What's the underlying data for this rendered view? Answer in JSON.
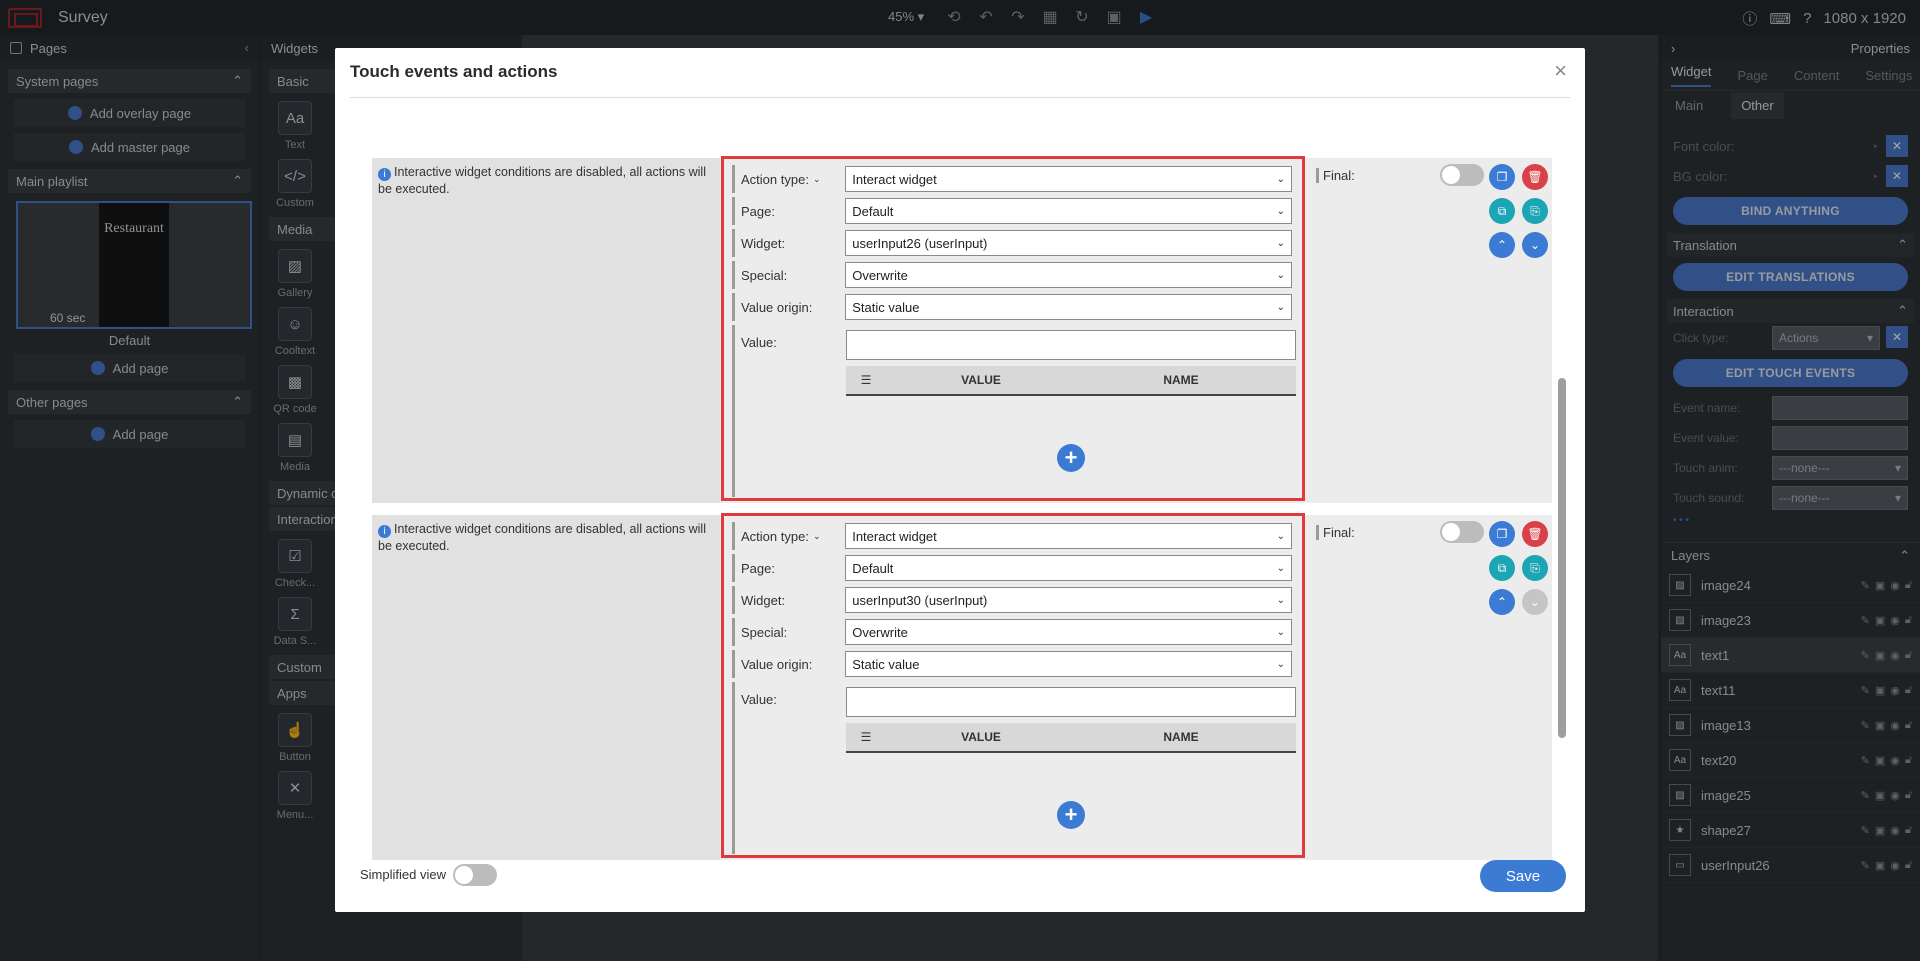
{
  "app": {
    "title": "Survey",
    "zoom": "45% ▾",
    "resolution": "1080 x 1920"
  },
  "pages_panel": {
    "title": "Pages",
    "system_pages": "System pages",
    "add_overlay": "Add overlay page",
    "add_master": "Add master page",
    "main_playlist": "Main playlist",
    "thumb_seconds": "60",
    "thumb_unit": "sec",
    "thumb_title": "Restaurant",
    "thumb_label": "Default",
    "add_page": "Add page",
    "other_pages": "Other pages",
    "add_page2": "Add page"
  },
  "widgets_panel": {
    "title": "Widgets",
    "basic": "Basic",
    "basic_items": [
      "Text",
      "Custom"
    ],
    "media": "Media",
    "media_items": [
      "Gallery",
      "Cooltext",
      "QR code",
      "Media"
    ],
    "dynamic": "Dynamic c",
    "interaction": "Interaction",
    "interaction_items": [
      "Check...",
      "Data S..."
    ],
    "custom": "Custom",
    "apps": "Apps",
    "apps_items": [
      "Button",
      "Menu..."
    ]
  },
  "properties_panel": {
    "title": "Properties",
    "tabs": [
      "Widget",
      "Page",
      "Content",
      "Settings"
    ],
    "subtabs": [
      "Main",
      "Other"
    ],
    "font_color": "Font color:",
    "bg_color": "BG color:",
    "bind_anything": "BIND ANYTHING",
    "translation": "Translation",
    "edit_translations": "EDIT TRANSLATIONS",
    "interaction": "Interaction",
    "click_type_label": "Click type:",
    "click_type_value": "Actions",
    "edit_touch_events": "EDIT TOUCH EVENTS",
    "event_name": "Event name:",
    "event_value": "Event value:",
    "touch_anim_label": "Touch anim:",
    "touch_anim_value": "---none---",
    "touch_sound_label": "Touch sound:",
    "touch_sound_value": "---none---",
    "more": "• • •"
  },
  "layers": {
    "title": "Layers",
    "items": [
      {
        "name": "image24",
        "icon": "image-icon"
      },
      {
        "name": "image23",
        "icon": "image-icon"
      },
      {
        "name": "text1",
        "icon": "text-icon"
      },
      {
        "name": "text11",
        "icon": "text-icon"
      },
      {
        "name": "image13",
        "icon": "image-icon"
      },
      {
        "name": "text20",
        "icon": "text-icon"
      },
      {
        "name": "image25",
        "icon": "image-icon"
      },
      {
        "name": "shape27",
        "icon": "star-icon"
      },
      {
        "name": "userInput26",
        "icon": "input-icon"
      }
    ]
  },
  "modal": {
    "title": "Touch events and actions",
    "note": "Interactive widget conditions are disabled, all actions will be executed.",
    "labels": {
      "action_type": "Action type:",
      "page": "Page:",
      "widget": "Widget:",
      "special": "Special:",
      "value_origin": "Value origin:",
      "value": "Value:",
      "final": "Final:",
      "col_value": "VALUE",
      "col_name": "NAME"
    },
    "actions": [
      {
        "action_type": "Interact widget",
        "page": "Default",
        "widget": "userInput26 (userInput)",
        "special": "Overwrite",
        "value_origin": "Static value",
        "value": ""
      },
      {
        "action_type": "Interact widget",
        "page": "Default",
        "widget": "userInput30 (userInput)",
        "special": "Overwrite",
        "value_origin": "Static value",
        "value": ""
      }
    ],
    "simplified_view": "Simplified view",
    "save": "Save"
  },
  "colors": {
    "accent": "#3b7bd4",
    "danger": "#d94047",
    "highlight_border": "#e03a3a",
    "teal": "#1ba5b5"
  }
}
